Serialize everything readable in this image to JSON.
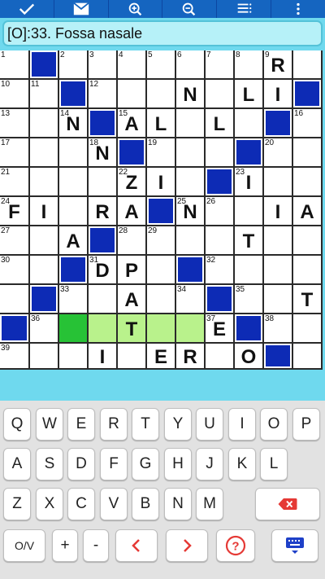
{
  "toolbar": {
    "buttons": [
      {
        "name": "check-button",
        "icon": "check-icon"
      },
      {
        "name": "mail-button",
        "icon": "envelope-icon"
      },
      {
        "name": "zoom-in-button",
        "icon": "zoom-in-icon"
      },
      {
        "name": "zoom-out-button",
        "icon": "zoom-out-icon"
      },
      {
        "name": "list-button",
        "icon": "list-icon"
      },
      {
        "name": "more-button",
        "icon": "more-vertical-icon"
      }
    ]
  },
  "clue": {
    "text": "[O]:33. Fossa nasale"
  },
  "grid": {
    "rows": 11,
    "cols": 11,
    "current_cell": [
      9,
      2
    ],
    "highlight_cells": [
      [
        9,
        3
      ],
      [
        9,
        4
      ],
      [
        9,
        5
      ],
      [
        9,
        6
      ]
    ],
    "cells": [
      [
        {
          "n": "1"
        },
        {
          "b": true
        },
        {
          "n": "2"
        },
        {
          "n": "3"
        },
        {
          "n": "4"
        },
        {
          "n": "5"
        },
        {
          "n": "6"
        },
        {
          "n": "7"
        },
        {
          "n": "8"
        },
        {
          "n": "9",
          "l": "R"
        },
        {}
      ],
      [
        {
          "n": "10"
        },
        {
          "n": "11"
        },
        {
          "b": true
        },
        {
          "n": "12"
        },
        {},
        {},
        {
          "l": "N"
        },
        {},
        {
          "l": "L"
        },
        {
          "l": "I"
        },
        {
          "b": true
        }
      ],
      [
        {
          "n": "13"
        },
        {},
        {
          "n": "14",
          "l": "N"
        },
        {
          "b": true
        },
        {
          "n": "15",
          "l": "A"
        },
        {
          "l": "L"
        },
        {},
        {
          "l": "L"
        },
        {},
        {
          "b": true
        },
        {
          "n": "16"
        }
      ],
      [
        {
          "n": "17"
        },
        {},
        {},
        {
          "n": "18",
          "l": "N"
        },
        {
          "b": true
        },
        {
          "n": "19"
        },
        {},
        {},
        {
          "b": true
        },
        {
          "n": "20"
        },
        {}
      ],
      [
        {
          "n": "21"
        },
        {},
        {},
        {},
        {
          "n": "22",
          "l": "Z"
        },
        {
          "l": "I"
        },
        {},
        {
          "b": true
        },
        {
          "n": "23",
          "l": "I"
        },
        {},
        {}
      ],
      [
        {
          "n": "24",
          "l": "F"
        },
        {
          "l": "I"
        },
        {},
        {
          "l": "R"
        },
        {
          "l": "A"
        },
        {
          "b": true
        },
        {
          "n": "25",
          "l": "N"
        },
        {
          "n": "26"
        },
        {},
        {
          "l": "I"
        },
        {
          "l": "A"
        }
      ],
      [
        {
          "n": "27"
        },
        {},
        {
          "l": "A"
        },
        {
          "b": true
        },
        {
          "n": "28"
        },
        {
          "n": "29"
        },
        {},
        {},
        {
          "l": "T"
        },
        {},
        {}
      ],
      [
        {
          "n": "30"
        },
        {},
        {
          "b": true
        },
        {
          "n": "31",
          "l": "D"
        },
        {
          "l": "P"
        },
        {},
        {
          "b": true
        },
        {
          "n": "32"
        },
        {},
        {},
        {}
      ],
      [
        {},
        {
          "b": true
        },
        {
          "n": "33"
        },
        {},
        {
          "l": "A"
        },
        {},
        {
          "n": "34"
        },
        {
          "b": true
        },
        {
          "n": "35"
        },
        {},
        {
          "l": "T"
        }
      ],
      [
        {
          "b": true
        },
        {
          "n": "36"
        },
        {},
        {},
        {
          "l": "T"
        },
        {},
        {},
        {
          "n": "37",
          "l": "E"
        },
        {
          "b": true
        },
        {
          "n": "38"
        },
        {}
      ],
      [
        {
          "n": "39"
        },
        {},
        {},
        {
          "l": "I"
        },
        {},
        {
          "l": "E"
        },
        {
          "l": "R"
        },
        {},
        {
          "l": "O"
        },
        {
          "b": true
        },
        {}
      ]
    ]
  },
  "keyboard": {
    "rows": [
      [
        "Q",
        "W",
        "E",
        "R",
        "T",
        "Y",
        "U",
        "I",
        "O",
        "P"
      ],
      [
        "A",
        "S",
        "D",
        "F",
        "G",
        "H",
        "J",
        "K",
        "L"
      ],
      [
        "Z",
        "X",
        "C",
        "V",
        "B",
        "N",
        "M"
      ]
    ],
    "backspace_icon": "backspace-icon",
    "bottom": [
      {
        "name": "mode-key",
        "label": "O/V"
      },
      {
        "name": "plus-key",
        "label": "+"
      },
      {
        "name": "minus-key",
        "label": "-"
      },
      {
        "name": "prev-key",
        "icon": "chevron-left-icon"
      },
      {
        "name": "next-key",
        "icon": "chevron-right-icon"
      },
      {
        "name": "help-key",
        "icon": "help-icon"
      },
      {
        "name": "keyboard-key",
        "icon": "keyboard-icon"
      }
    ],
    "accent_red": "#e53935",
    "accent_blue": "#1e40c8"
  }
}
